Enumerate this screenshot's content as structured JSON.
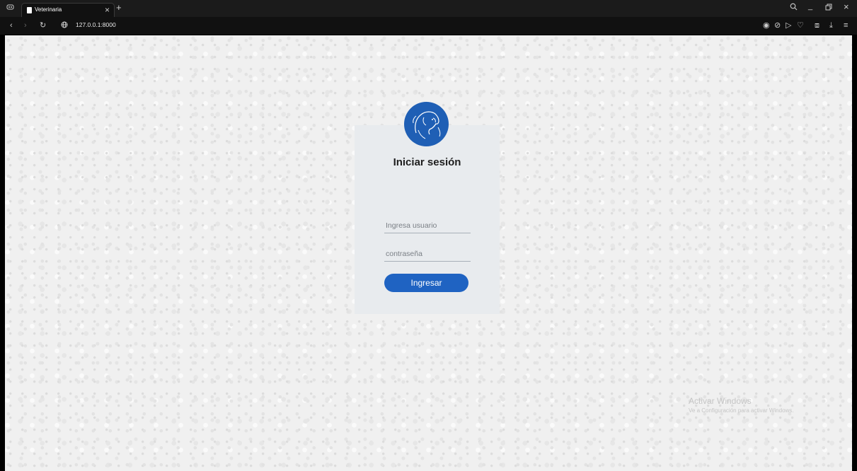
{
  "browser": {
    "tab_title": "Veterinaria",
    "url": "127.0.0.1:8000"
  },
  "login": {
    "title": "Iniciar sesión",
    "username_placeholder": "Ingresa usuario",
    "password_placeholder": "contraseña",
    "submit_label": "Ingresar"
  },
  "watermark": {
    "line1": "Activar Windows",
    "line2": "Ve a Configuración para activar Windows."
  },
  "colors": {
    "accent": "#1f63c2",
    "card": "#e8ebee",
    "chrome": "#1b1b1b"
  },
  "icons": {
    "avatar": "dog-cat-logo",
    "tab_favicon": "page-icon"
  }
}
